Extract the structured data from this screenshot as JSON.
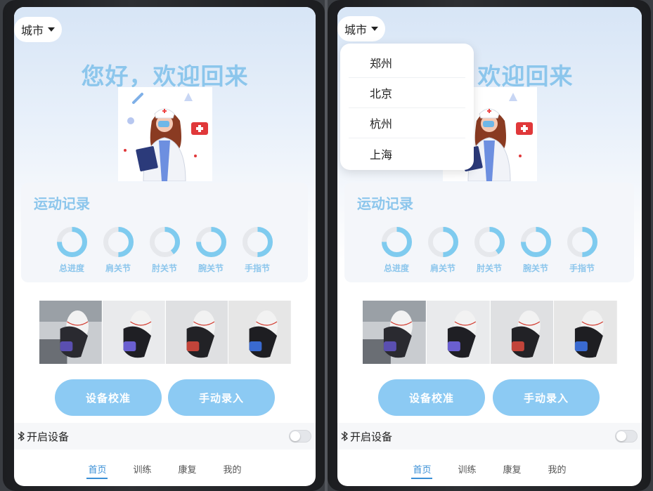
{
  "city_selector": {
    "label": "城市"
  },
  "greeting": "您好，欢迎回来",
  "greeting_partial": "欢迎回来",
  "records": {
    "title": "运动记录",
    "items": [
      {
        "label": "总进度",
        "progress": 0.75
      },
      {
        "label": "肩关节",
        "progress": 0.5
      },
      {
        "label": "肘关节",
        "progress": 0.4
      },
      {
        "label": "腕关节",
        "progress": 0.75
      },
      {
        "label": "手指节",
        "progress": 0.5
      }
    ]
  },
  "buttons": {
    "calibrate": "设备校准",
    "manual_entry": "手动录入"
  },
  "device": {
    "label": "开启设备",
    "enabled": false
  },
  "tabs": [
    {
      "label": "首页",
      "active": true
    },
    {
      "label": "训练",
      "active": false
    },
    {
      "label": "康复",
      "active": false
    },
    {
      "label": "我的",
      "active": false
    }
  ],
  "city_dropdown": {
    "options": [
      "郑州",
      "北京",
      "杭州",
      "上海"
    ]
  },
  "colors": {
    "accent": "#8cc6ec",
    "button": "#8ccaf3",
    "ring": "#7fcbef",
    "ring_track": "#e6e8ec",
    "tab_active": "#3a8fd6"
  }
}
